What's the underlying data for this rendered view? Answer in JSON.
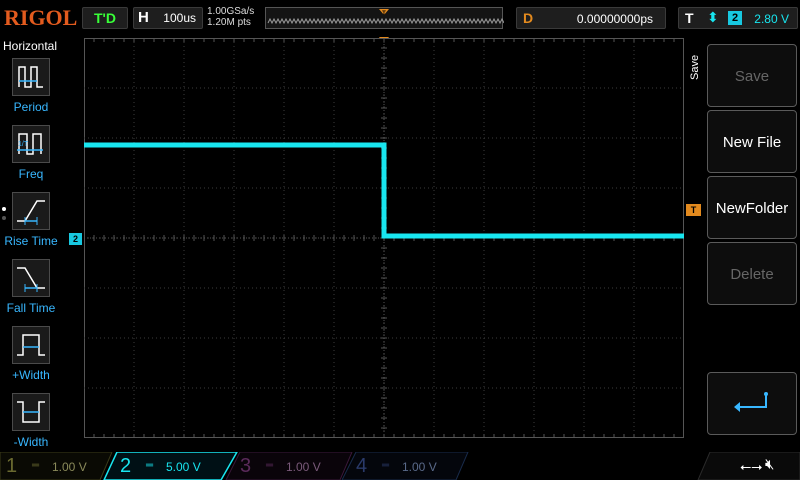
{
  "header": {
    "brand": "RIGOL",
    "trigger_status": "T'D",
    "timebase_label": "H",
    "timebase_value": "100us",
    "sample_rate": "1.00GSa/s",
    "memory_depth": "1.20M pts",
    "delay_label": "D",
    "delay_value": "0.00000000ps",
    "trigger_label": "T",
    "trigger_source": "2",
    "trigger_level": "2.80 V"
  },
  "left_panel": {
    "title": "Horizontal",
    "items": [
      {
        "label": "Period",
        "icon": "period-icon"
      },
      {
        "label": "Freq",
        "icon": "frequency-icon"
      },
      {
        "label": "Rise Time",
        "icon": "rise-time-icon"
      },
      {
        "label": "Fall Time",
        "icon": "fall-time-icon"
      },
      {
        "label": "+Width",
        "icon": "positive-width-icon"
      },
      {
        "label": "-Width",
        "icon": "negative-width-icon"
      }
    ]
  },
  "screen": {
    "channel_marker": "2",
    "trigger_marker": "T",
    "waveform_color": "#18e6f0",
    "grid_color": "#3c3c3c"
  },
  "right_menu": {
    "title": "Save",
    "buttons": [
      {
        "label": "Save",
        "enabled": false
      },
      {
        "label": "New File",
        "enabled": true
      },
      {
        "label": "NewFolder",
        "enabled": true
      },
      {
        "label": "Delete",
        "enabled": false
      },
      {
        "label": "",
        "icon": "return-icon"
      }
    ]
  },
  "channels": [
    {
      "num": "1",
      "coupling": "═",
      "scale": "1.00 V",
      "color": "#8a8a3a",
      "active": false
    },
    {
      "num": "2",
      "coupling": "═",
      "scale": "5.00 V",
      "color": "#18e6f0",
      "active": true
    },
    {
      "num": "3",
      "coupling": "═",
      "scale": "1.00 V",
      "color": "#7a3a7a",
      "active": false
    },
    {
      "num": "4",
      "coupling": "═",
      "scale": "1.00 V",
      "color": "#3a5a9a",
      "active": false
    }
  ],
  "status_icons": [
    "usb-icon",
    "speaker-muted-icon"
  ]
}
